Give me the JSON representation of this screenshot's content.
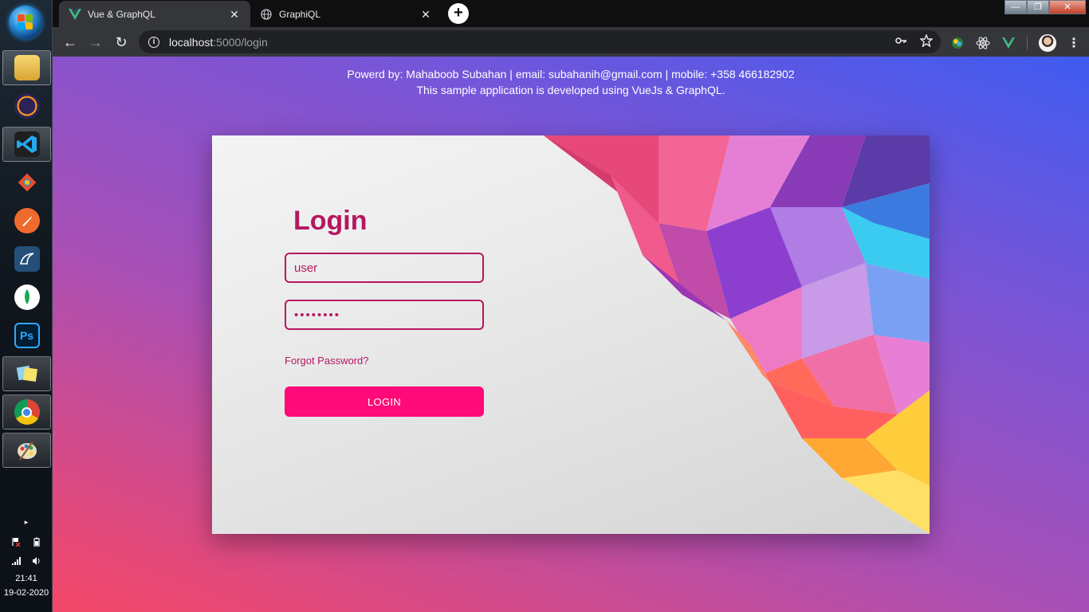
{
  "taskbar": {
    "clock_time": "21:41",
    "clock_date": "19-02-2020"
  },
  "browser": {
    "tabs": [
      {
        "title": "Vue & GraphQL",
        "active": true,
        "icon": "vue-icon"
      },
      {
        "title": "GraphiQL",
        "active": false,
        "icon": "globe-icon"
      }
    ],
    "url_host": "localhost",
    "url_rest": ":5000/login"
  },
  "page": {
    "credits_line1": "Powerd by: Mahaboob Subahan | email: subahanih@gmail.com | mobile: +358 466182902",
    "credits_line2": "This sample application is developed using VueJs & GraphQL.",
    "login": {
      "title": "Login",
      "username_value": "user",
      "password_value": "••••••••",
      "forgot_label": "Forgot Password?",
      "button_label": "LOGIN"
    }
  },
  "colors": {
    "accent": "#b5175f",
    "button": "#ff0a78",
    "bg_top": "#3f5bf0",
    "bg_bottom": "#f44868"
  }
}
